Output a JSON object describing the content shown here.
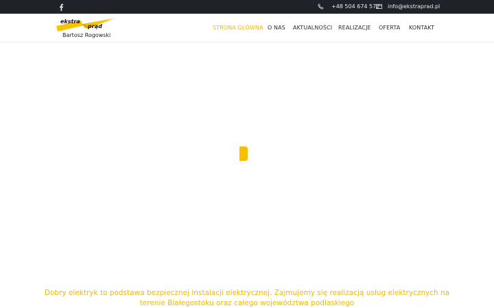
{
  "topbar": {
    "social": [
      {
        "icon": "facebook-icon"
      }
    ],
    "phone": {
      "icon": "phone-icon",
      "text": "+48 504 674 572"
    },
    "email": {
      "icon": "mail-icon",
      "text": "info@ekstraprad.pl"
    }
  },
  "logo": {
    "word1": "ekstra",
    "word2": "prąd",
    "owner": "Bartosz Rogowski",
    "icon": "lightning-bolt-icon"
  },
  "nav": {
    "items": [
      {
        "label": "STRONA GŁÓWNA",
        "active": true
      },
      {
        "label": "O NAS",
        "active": false
      },
      {
        "label": "AKTUALNOŚCI",
        "active": false
      },
      {
        "label": "REALIZACJE",
        "active": false
      },
      {
        "label": "OFERTA",
        "active": false
      },
      {
        "label": "KONTAKT",
        "active": false
      }
    ]
  },
  "hero": {
    "loader_icon": "loading-spinner-icon",
    "tagline_line1": "Dobry elektryk to podstawa bezpiecznej instalacji elektrycznej. Zajmujemy się realizacją usług elektrycznych na",
    "tagline_line2": "terenie Białegostoku oraz całego województwa podlaskiego"
  },
  "colors": {
    "accent": "#f2b900",
    "topbar_bg": "#1f2329",
    "text": "#2b2b2b"
  }
}
